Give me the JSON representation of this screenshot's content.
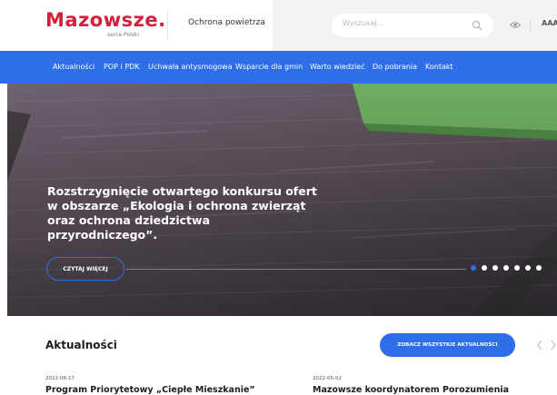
{
  "header": {
    "logo_text": "Mazowsze.",
    "logo_subtext": "serce Polski",
    "site_name": "Ochrona powietrza",
    "search_placeholder": "Wyszukaj...",
    "font_size_label": "AAA",
    "brand_color": "#d21f3c",
    "accent_color": "#2e6ee8"
  },
  "nav": {
    "items": [
      "Aktualności",
      "POP i PDK",
      "Uchwała antysmogowa",
      "Wsparcie dla gmin",
      "Warto wiedzieć",
      "Do pobrania",
      "Kontakt"
    ]
  },
  "hero": {
    "title_lines": [
      "Rozstrzygnięcie otwartego konkursu ofert",
      "w obszarze „Ekologia i ochrona zwierząt",
      "oraz ochrona dziedzictwa",
      "przyrodniczego”."
    ],
    "read_more_label": "CZYTAJ WIĘCEJ",
    "slides_count": 7,
    "active_slide": 1
  },
  "news": {
    "section_title": "Aktualności",
    "see_all_label": "ZOBACZ WSZYSTKIE AKTUALNOŚCI",
    "items": [
      {
        "date": "2022-08-17",
        "title": "Program Priorytetowy „Ciepłe Mieszkanie”"
      },
      {
        "date": "2022-05-02",
        "title": "Mazowsze koordynatorem Porozumienia"
      }
    ]
  }
}
